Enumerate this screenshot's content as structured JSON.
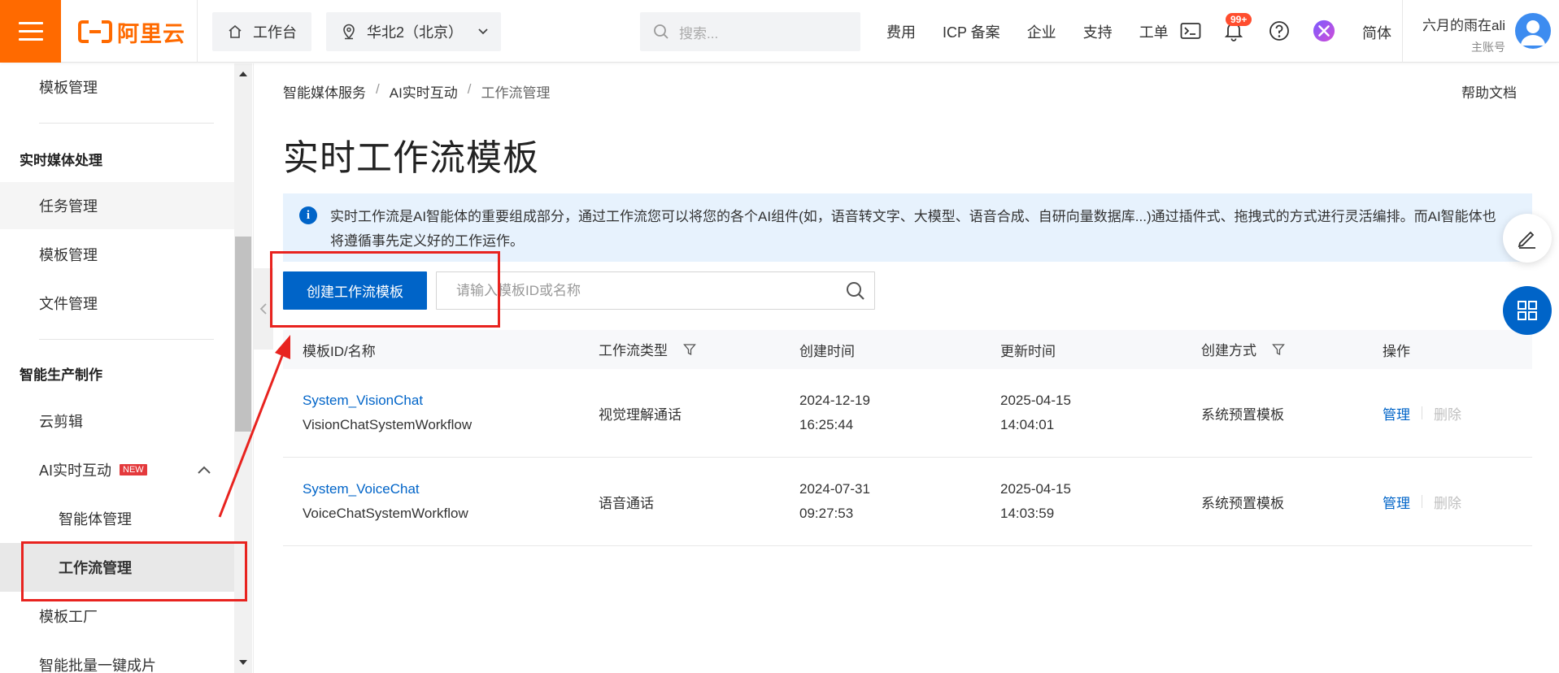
{
  "topbar": {
    "logo_text": "阿里云",
    "workbench_label": "工作台",
    "region_label": "华北2（北京）",
    "search_placeholder": "搜索...",
    "nav_links": [
      "费用",
      "ICP 备案",
      "企业",
      "支持",
      "工单"
    ],
    "notification_badge": "99+",
    "language_label": "简体",
    "user_name": "六月的雨在ali",
    "user_role": "主账号",
    "icons": [
      "hamburger-icon",
      "home-icon",
      "location-icon",
      "chevron-down-icon",
      "search-icon",
      "terminal-icon",
      "bell-icon",
      "help-icon",
      "ai-assistant-icon",
      "avatar"
    ]
  },
  "sidebar": {
    "items": [
      {
        "label": "模板管理",
        "level": 1
      },
      {
        "label": "实时媒体处理",
        "level": 0
      },
      {
        "label": "任务管理",
        "level": 1
      },
      {
        "label": "模板管理",
        "level": 1
      },
      {
        "label": "文件管理",
        "level": 1
      },
      {
        "label": "智能生产制作",
        "level": 0
      },
      {
        "label": "云剪辑",
        "level": 1
      },
      {
        "label": "AI实时互动",
        "level": 1,
        "badge": "NEW",
        "expanded": true
      },
      {
        "label": "智能体管理",
        "level": 2
      },
      {
        "label": "工作流管理",
        "level": 2,
        "active": true
      },
      {
        "label": "模板工厂",
        "level": 1
      },
      {
        "label": "智能批量一键成片",
        "level": 1
      }
    ]
  },
  "main": {
    "breadcrumb": [
      "智能媒体服务",
      "AI实时互动",
      "工作流管理"
    ],
    "help_link": "帮助文档",
    "title": "实时工作流模板",
    "notice": "实时工作流是AI智能体的重要组成部分，通过工作流您可以将您的各个AI组件(如，语音转文字、大模型、语音合成、自研向量数据库...)通过插件式、拖拽式的方式进行灵活编排。而AI智能体也将遵循事先定义好的工作运作。",
    "create_button": "创建工作流模板",
    "search_placeholder": "请输入模板ID或名称",
    "table": {
      "headers": [
        "模板ID/名称",
        "工作流类型",
        "创建时间",
        "更新时间",
        "创建方式",
        "操作"
      ],
      "rows": [
        {
          "id": "System_VisionChat",
          "name": "VisionChatSystemWorkflow",
          "type": "视觉理解通话",
          "created_date": "2024-12-19",
          "created_time": "16:25:44",
          "updated_date": "2025-04-15",
          "updated_time": "14:04:01",
          "method": "系统预置模板",
          "action_manage": "管理",
          "action_delete": "删除"
        },
        {
          "id": "System_VoiceChat",
          "name": "VoiceChatSystemWorkflow",
          "type": "语音通话",
          "created_date": "2024-07-31",
          "created_time": "09:27:53",
          "updated_date": "2025-04-15",
          "updated_time": "14:03:59",
          "method": "系统预置模板",
          "action_manage": "管理",
          "action_delete": "删除"
        }
      ]
    }
  },
  "colors": {
    "brand_orange": "#ff6a00",
    "primary_blue": "#0064c8",
    "notice_bg": "#e7f2fd",
    "annotation_red": "#e8231f"
  }
}
